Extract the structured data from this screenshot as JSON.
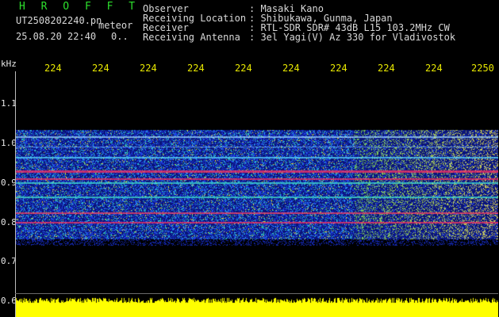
{
  "header": {
    "title": "H R O F F T",
    "filename": "UT2508202240.pn",
    "mode": "meteor",
    "datetime": "25.08.20 22:40",
    "extra": "0..",
    "info": [
      {
        "label": "Observer",
        "value": ": Masaki Kano"
      },
      {
        "label": "Receiving Location",
        "value": ": Shibukawa, Gunma, Japan"
      },
      {
        "label": "Receiver",
        "value": ": RTL-SDR SDR# 43dB L15 103.2MHz CW"
      },
      {
        "label": "Receiving Antenna",
        "value": ": 3el Yagi(V) Az 330 for Vladivostok"
      }
    ]
  },
  "axis": {
    "unit": "kHz",
    "x_ticks": [
      "224",
      "224",
      "224",
      "224",
      "224",
      "224",
      "224",
      "224",
      "224",
      "2250"
    ],
    "y_ticks": [
      "1.1",
      "1.0",
      "0.9",
      "0.8",
      "0.7",
      "0.6"
    ]
  },
  "colors": {
    "background": "#000000",
    "title": "#2de02d",
    "tick": "#e8e800",
    "power": "#ffff00"
  }
}
